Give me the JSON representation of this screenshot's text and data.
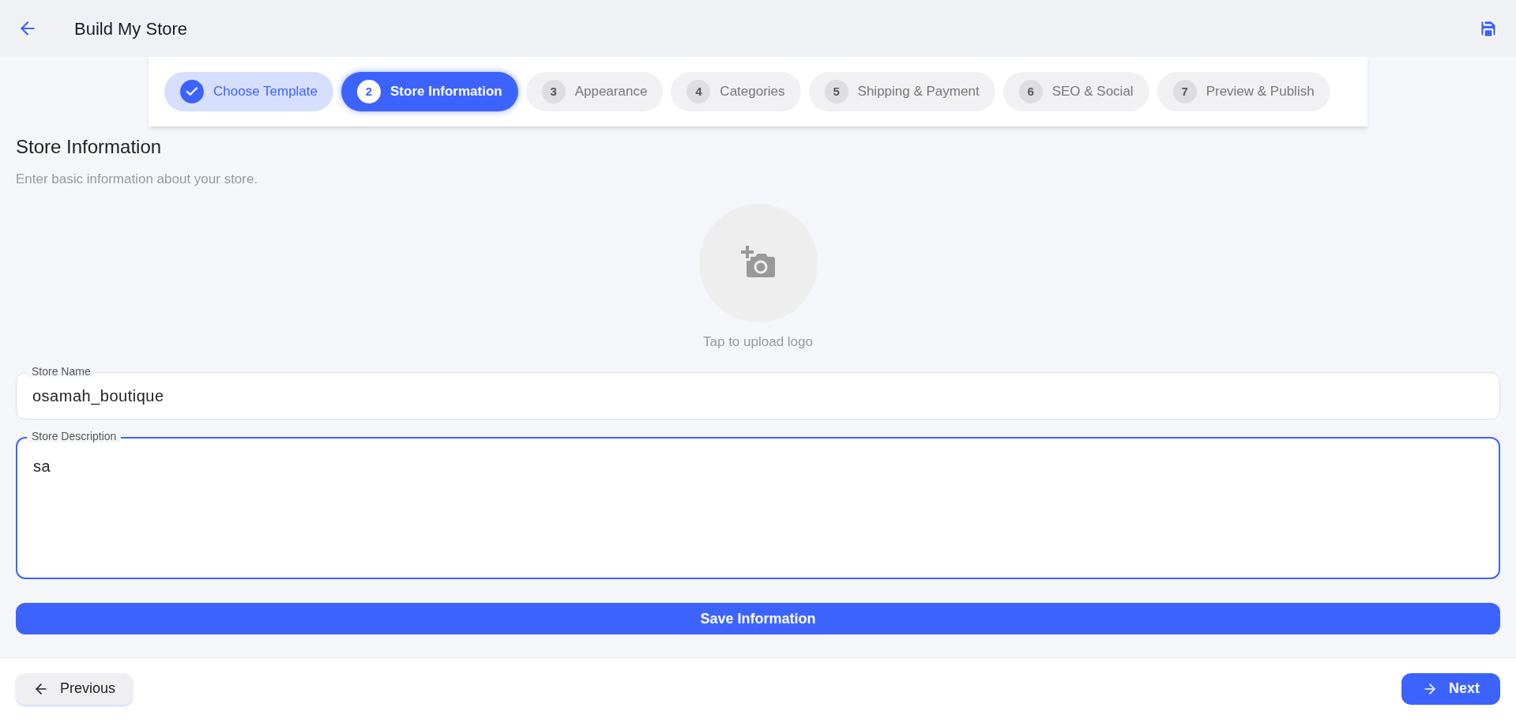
{
  "header": {
    "title": "Build My Store"
  },
  "steps": [
    {
      "label": "Choose Template",
      "selected": false,
      "done": true
    },
    {
      "number": "2",
      "label": "Store Information",
      "selected": true,
      "done": false
    },
    {
      "number": "3",
      "label": "Appearance",
      "selected": false,
      "done": false
    },
    {
      "number": "4",
      "label": "Categories",
      "selected": false,
      "done": false
    },
    {
      "number": "5",
      "label": "Shipping & Payment",
      "selected": false,
      "done": false
    },
    {
      "number": "6",
      "label": "SEO & Social",
      "selected": false,
      "done": false
    },
    {
      "number": "7",
      "label": "Preview & Publish",
      "selected": false,
      "done": false
    }
  ],
  "section": {
    "title": "Store Information",
    "subtitle": "Enter basic information about your store."
  },
  "logo_upload": {
    "caption": "Tap to upload logo"
  },
  "fields": [
    {
      "label": "Store Name",
      "value": "osamah_boutique",
      "focused": false,
      "kind": "input"
    },
    {
      "label": "Store Description",
      "value": "sa",
      "focused": true,
      "kind": "textarea"
    }
  ],
  "save_button": "Save Information",
  "footer": {
    "previous": "Previous",
    "next": "Next"
  }
}
